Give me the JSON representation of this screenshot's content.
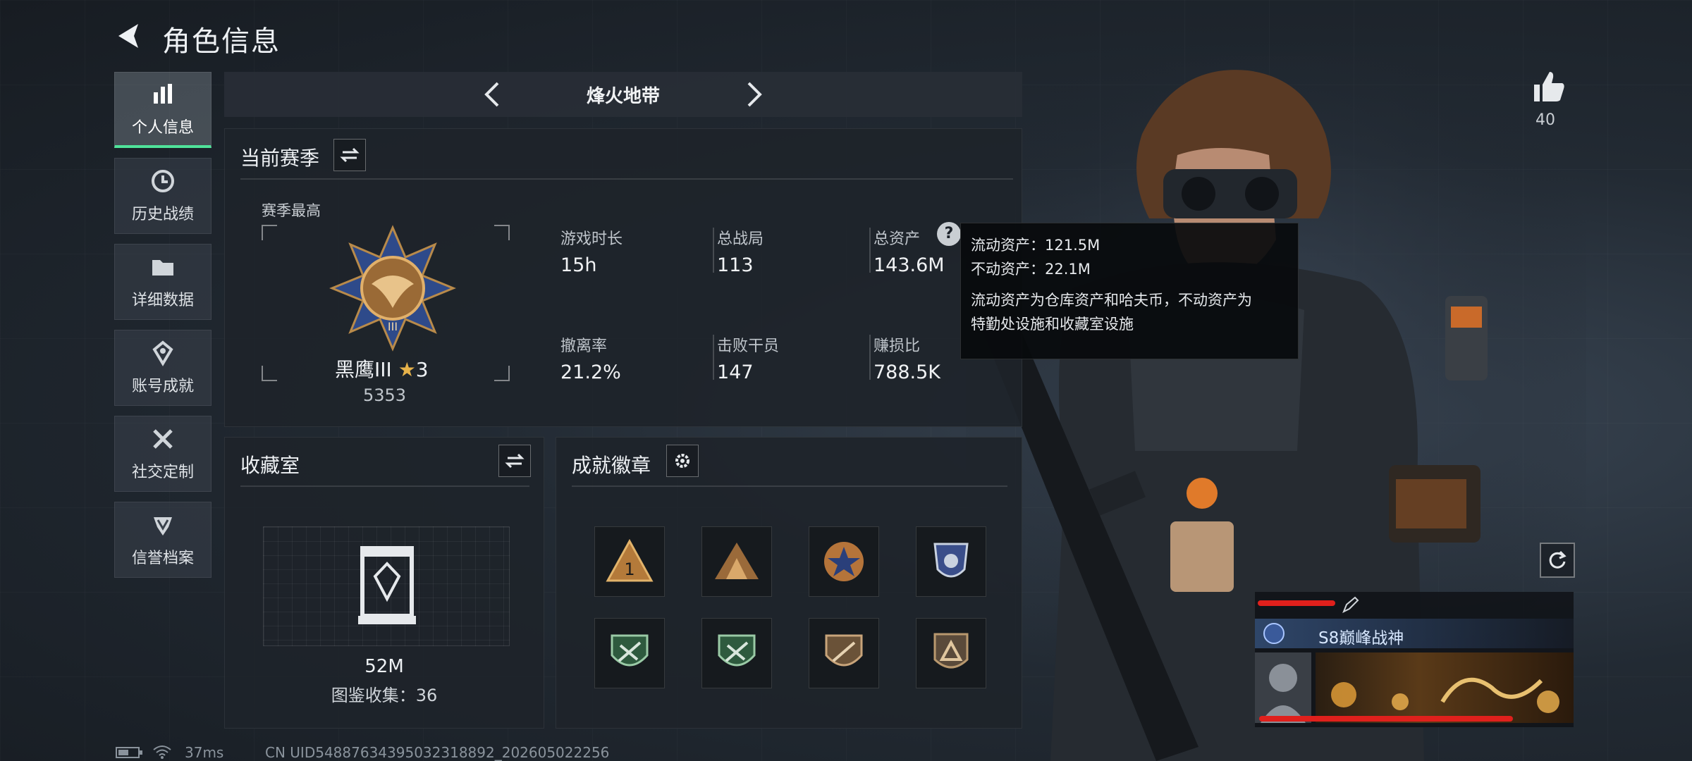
{
  "header": {
    "title": "角色信息"
  },
  "nav": {
    "items": [
      {
        "label": "个人信息",
        "icon": "bar-chart-icon",
        "active": true
      },
      {
        "label": "历史战绩",
        "icon": "clock-icon",
        "active": false
      },
      {
        "label": "详细数据",
        "icon": "folder-icon",
        "active": false
      },
      {
        "label": "账号成就",
        "icon": "achievement-icon",
        "active": false
      },
      {
        "label": "社交定制",
        "icon": "tools-icon",
        "active": false
      },
      {
        "label": "信誉档案",
        "icon": "shield-icon",
        "active": false
      }
    ]
  },
  "mode": {
    "title": "烽火地带"
  },
  "season": {
    "title": "当前赛季",
    "best_label": "赛季最高",
    "rank_name": "黑鹰III",
    "rank_stars": "3",
    "rank_score": "5353",
    "stats": [
      {
        "label": "游戏时长",
        "value": "15h"
      },
      {
        "label": "总战局",
        "value": "113"
      },
      {
        "label": "总资产",
        "value": "143.6M"
      },
      {
        "label": "撤离率",
        "value": "21.2%"
      },
      {
        "label": "击败干员",
        "value": "147"
      },
      {
        "label": "赚损比",
        "value": "788.5K"
      }
    ]
  },
  "tooltip": {
    "liquid": "流动资产：121.5M",
    "fixed": "不动资产：22.1M",
    "desc_line1": "流动资产为仓库资产和哈夫币，不动资产为",
    "desc_line2": "特勤处设施和收藏室设施"
  },
  "collection": {
    "title": "收藏室",
    "value": "52M",
    "catalog": "图鉴收集：36"
  },
  "badges": {
    "title": "成就徽章",
    "items": [
      "badge-1",
      "badge-2",
      "badge-3",
      "badge-4",
      "badge-5",
      "badge-6",
      "badge-7",
      "badge-8"
    ]
  },
  "likes": {
    "count": "40"
  },
  "card": {
    "title_tag": "S8巅峰战神"
  },
  "status": {
    "ping": "37ms",
    "uid": "CN UID5488763439503231889​2_202605022256"
  },
  "colors": {
    "accent": "#4fe39a",
    "background": "#1b2129",
    "tooltip": "#08090c",
    "redline": "#e0201c"
  }
}
